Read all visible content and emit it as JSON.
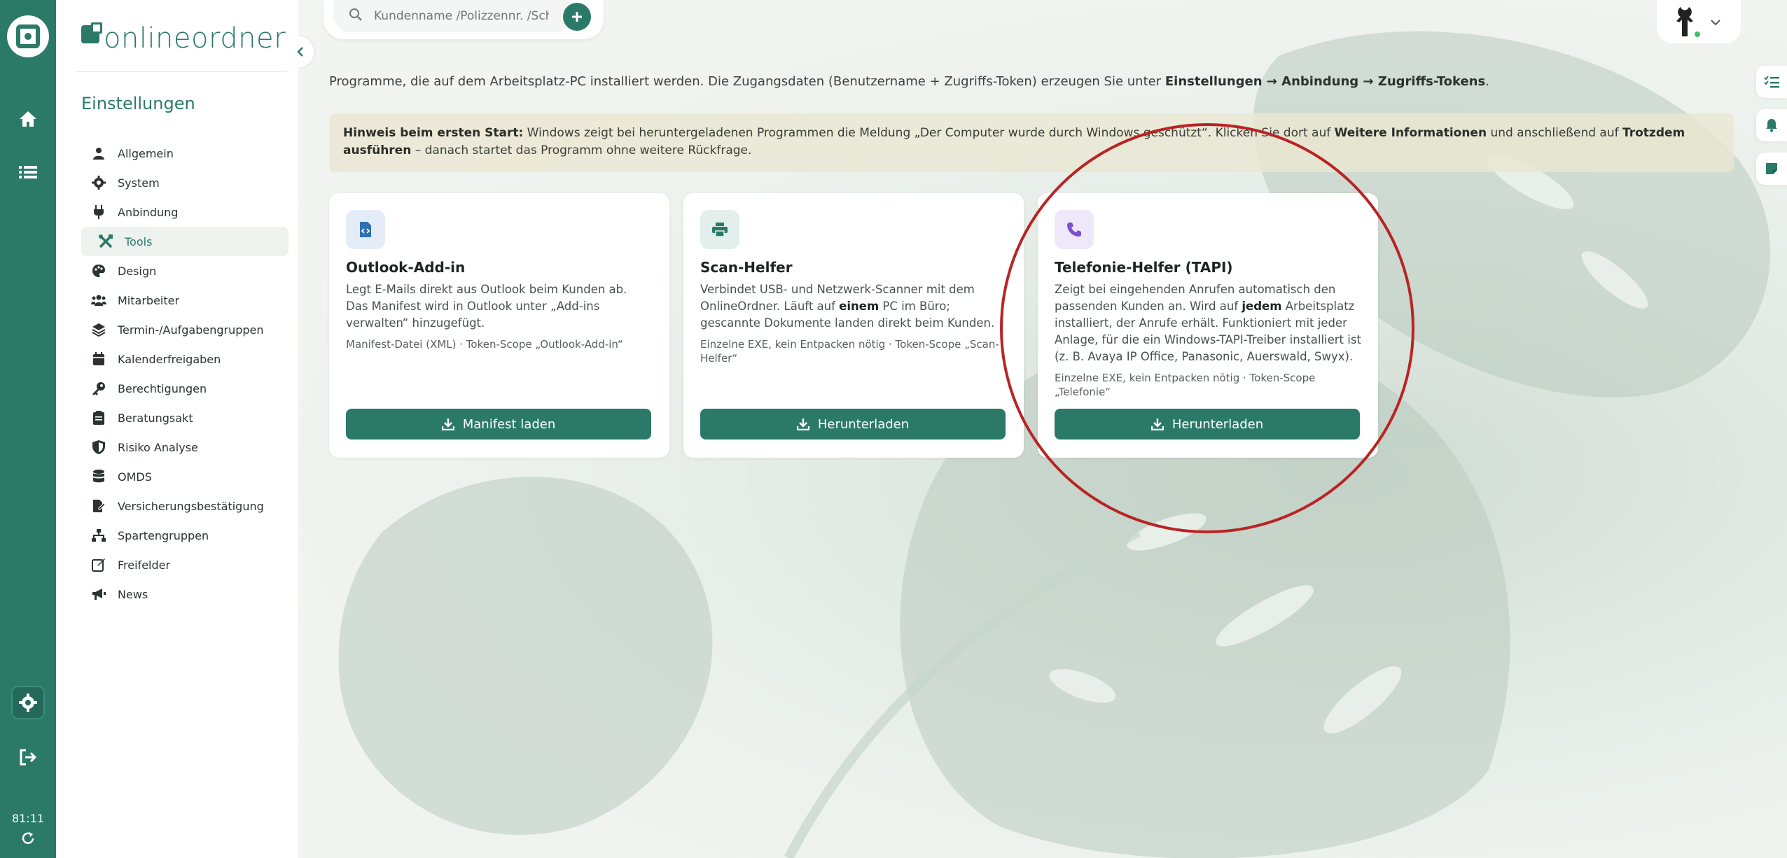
{
  "app": {
    "brand": "onlineordner"
  },
  "rail": {
    "time": "81:11"
  },
  "settings": {
    "title": "Einstellungen",
    "items": [
      {
        "label": "Allgemein",
        "icon": "user-icon"
      },
      {
        "label": "System",
        "icon": "gear-icon"
      },
      {
        "label": "Anbindung",
        "icon": "plug-icon"
      },
      {
        "label": "Tools",
        "icon": "tools-icon",
        "active": true
      },
      {
        "label": "Design",
        "icon": "palette-icon"
      },
      {
        "label": "Mitarbeiter",
        "icon": "users-icon"
      },
      {
        "label": "Termin-/Aufgabengruppen",
        "icon": "layers-icon"
      },
      {
        "label": "Kalenderfreigaben",
        "icon": "calendar-icon"
      },
      {
        "label": "Berechtigungen",
        "icon": "key-icon"
      },
      {
        "label": "Beratungsakt",
        "icon": "clipboard-icon"
      },
      {
        "label": "Risiko Analyse",
        "icon": "shield-icon"
      },
      {
        "label": "OMDS",
        "icon": "database-icon"
      },
      {
        "label": "Versicherungsbestätigung",
        "icon": "file-signature-icon"
      },
      {
        "label": "Spartengruppen",
        "icon": "sitemap-icon"
      },
      {
        "label": "Freifelder",
        "icon": "edit-icon"
      },
      {
        "label": "News",
        "icon": "megaphone-icon"
      }
    ]
  },
  "search": {
    "placeholder": "Kundenname /Polizzennr. /Schadennr."
  },
  "main": {
    "intro": {
      "prefix": "Programme, die auf dem Arbeitsplatz-PC installiert werden. Die Zugangsdaten (Benutzername + Zugriffs-Token) erzeugen Sie unter ",
      "path": "Einstellungen → Anbindung → Zugriffs-Tokens",
      "suffix": "."
    },
    "hint": {
      "lead": "Hinweis beim ersten Start:",
      "t1": " Windows zeigt bei heruntergeladenen Programmen die Meldung „Der Computer wurde durch Windows geschützt“. Klicken Sie dort auf ",
      "b1": "Weitere Informationen",
      "t2": " und anschließend auf ",
      "b2": "Trotzdem ausführen",
      "t3": " – danach startet das Programm ohne weitere Rückfrage."
    },
    "cards": [
      {
        "title": "Outlook-Add-in",
        "desc": "Legt E-Mails direkt aus Outlook beim Kunden ab. Das Manifest wird in Outlook unter „Add-ins verwalten“ hinzugefügt.",
        "meta": "Manifest-Datei (XML) · Token-Scope „Outlook-Add-in“",
        "button": "Manifest laden",
        "icon": "file-code-icon",
        "accent": "#2f6fb3"
      },
      {
        "title": "Scan-Helfer",
        "desc_a": "Verbindet USB- und Netzwerk-Scanner mit dem OnlineOrdner. Läuft auf ",
        "desc_b": "einem",
        "desc_c": " PC im Büro; gescannte Dokumente landen direkt beim Kunden.",
        "meta": "Einzelne EXE, kein Entpacken nötig · Token-Scope „Scan-Helfer“",
        "button": "Herunterladen",
        "icon": "printer-icon",
        "accent": "#2b7a68"
      },
      {
        "title": "Telefonie-Helfer (TAPI)",
        "desc_a": "Zeigt bei eingehenden Anrufen automatisch den passenden Kunden an. Wird auf ",
        "desc_b": "jedem",
        "desc_c": " Arbeitsplatz installiert, der Anrufe erhält. Funktioniert mit jeder Anlage, für die ein Windows-TAPI-Treiber installiert ist (z. B. Avaya IP Office, Panasonic, Auerswald, Swyx).",
        "meta": "Einzelne EXE, kein Entpacken nötig · Token-Scope „Telefonie“",
        "button": "Herunterladen",
        "icon": "phone-icon",
        "accent": "#7a4fd1"
      }
    ]
  },
  "colors": {
    "brand": "#2b7a68",
    "highlight": "#b82424"
  }
}
